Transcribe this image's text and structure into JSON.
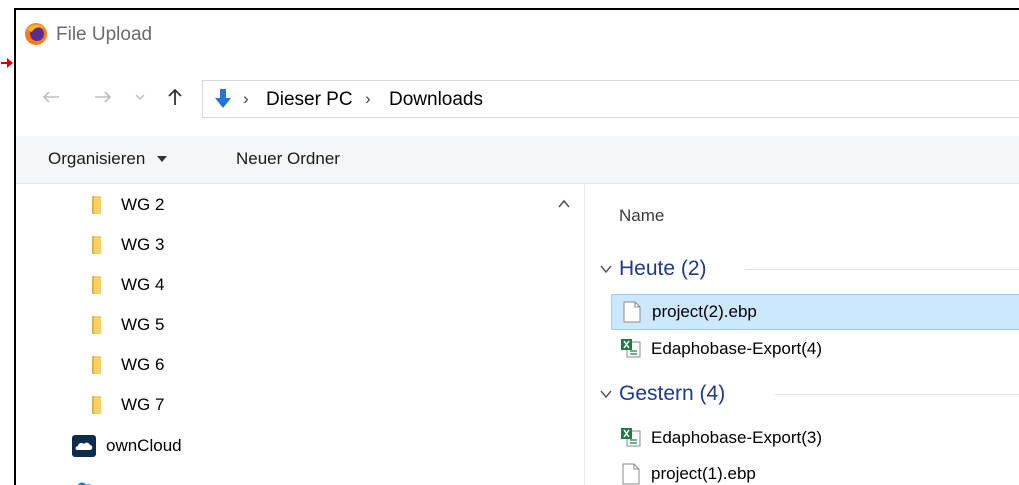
{
  "window": {
    "title": "File Upload",
    "app_icon": "firefox-icon"
  },
  "navigation": {
    "back_icon": "arrow-left-icon",
    "forward_icon": "arrow-right-icon",
    "recent_icon": "chevron-down-icon",
    "up_icon": "arrow-up-icon",
    "location_icon": "download-arrow-icon",
    "breadcrumb": [
      "Dieser PC",
      "Downloads"
    ]
  },
  "command_bar": {
    "organize_label": "Organisieren",
    "new_folder_label": "Neuer Ordner"
  },
  "tree": {
    "items": [
      {
        "label": "WG 2",
        "icon": "folder-icon"
      },
      {
        "label": "WG 3",
        "icon": "folder-icon"
      },
      {
        "label": "WG 4",
        "icon": "folder-icon"
      },
      {
        "label": "WG 5",
        "icon": "folder-icon"
      },
      {
        "label": "WG 6",
        "icon": "folder-icon"
      },
      {
        "label": "WG 7",
        "icon": "folder-icon"
      },
      {
        "label": "ownCloud",
        "icon": "owncloud-icon"
      }
    ]
  },
  "file_list": {
    "column_name": "Name",
    "groups": [
      {
        "label": "Heute (2)",
        "files": [
          {
            "label": "project(2).ebp",
            "icon": "document-icon",
            "selected": true
          },
          {
            "label": "Edaphobase-Export(4)",
            "icon": "excel-icon",
            "selected": false
          }
        ]
      },
      {
        "label": "Gestern (4)",
        "files": [
          {
            "label": "Edaphobase-Export(3)",
            "icon": "excel-icon",
            "selected": false
          },
          {
            "label": "project(1).ebp",
            "icon": "document-icon",
            "selected": false
          }
        ]
      }
    ]
  },
  "colors": {
    "group_header": "#1e3a8a",
    "selection_bg": "#cce8ff",
    "selection_border": "#99d1ff",
    "folder": "#f3cf6e",
    "location_icon": "#1e78d7",
    "annotation_arrow": "#d00000"
  }
}
